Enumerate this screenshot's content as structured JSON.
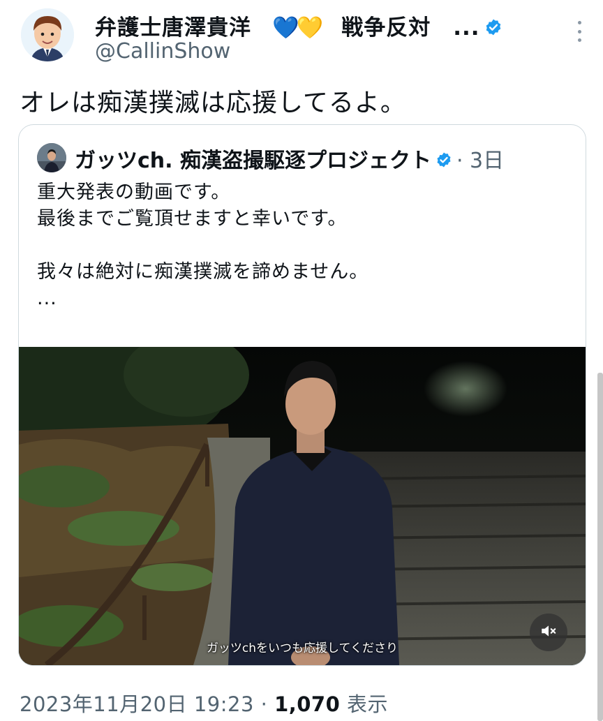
{
  "author": {
    "display_name": "弁護士唐澤貴洋",
    "emoji": "💙💛",
    "name_suffix": "戦争反対　...",
    "handle": "@CallinShow",
    "verified": true
  },
  "tweet": {
    "text": "オレは痴漢撲滅は応援してるよ。"
  },
  "quoted": {
    "author_name": "ガッツch. 痴漢盗撮駆逐プロジェクト",
    "time": "· 3日",
    "lines": [
      "重大発表の動画です。",
      "最後までご覧頂せますと幸いです。",
      "",
      "我々は絶対に痴漢撲滅を諦めません。",
      "..."
    ],
    "video": {
      "caption": "ガッツchをいつも応援してくださり",
      "mute_icon": "mute-icon"
    }
  },
  "meta": {
    "datetime": "2023年11月20日 19:23 · ",
    "views_count": "1,070",
    "views_label": " 表示"
  },
  "colors": {
    "accent": "#1d9bf0",
    "muted_text": "#536471",
    "border": "#cfd9de"
  }
}
